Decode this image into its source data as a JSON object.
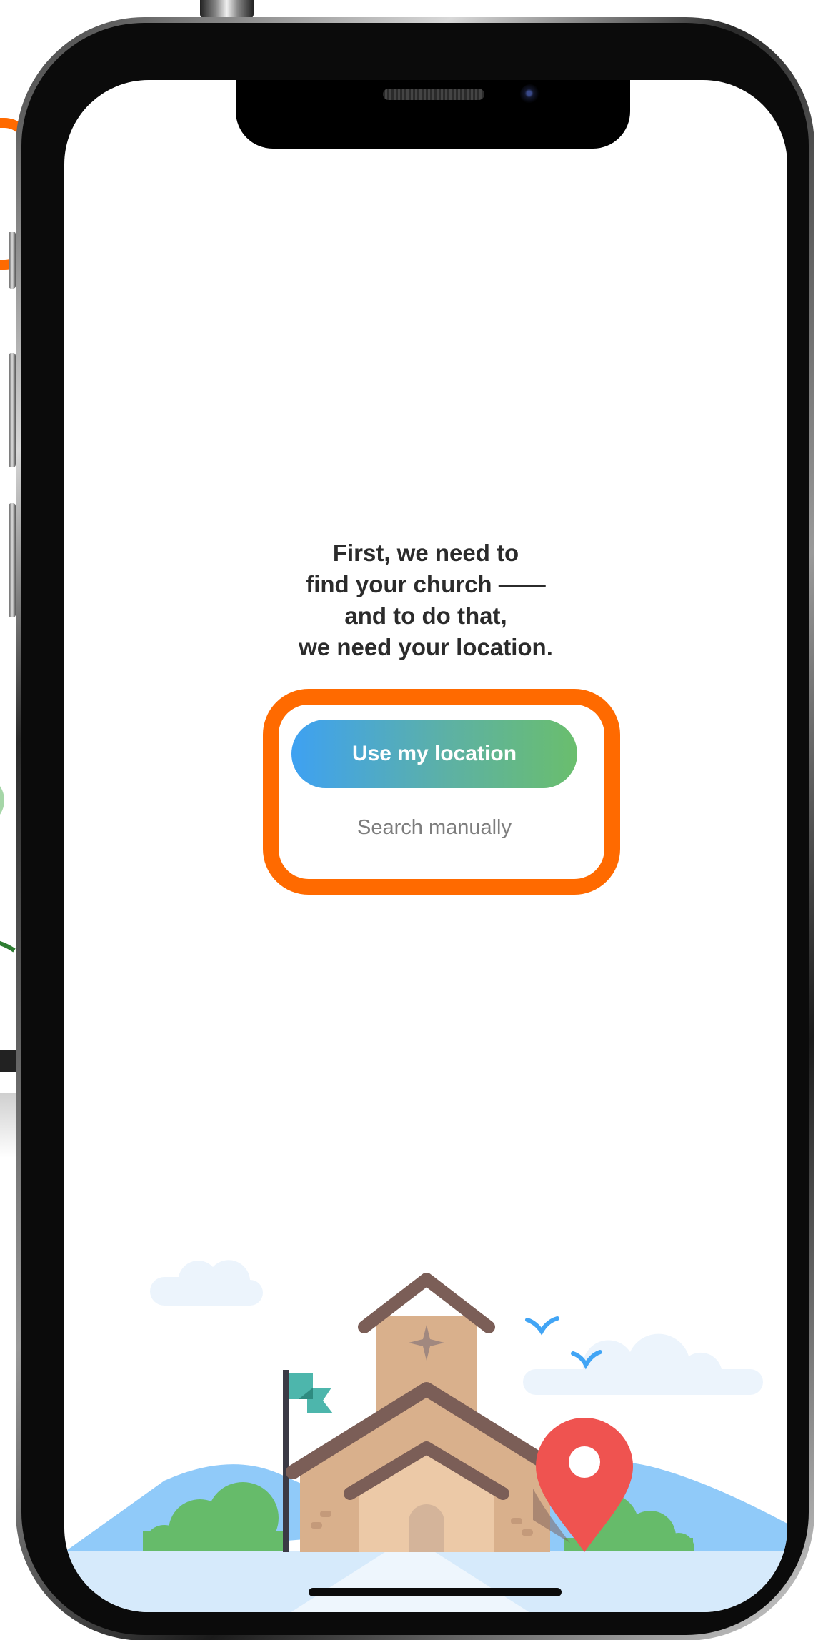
{
  "onboarding": {
    "message_lines": [
      "First, we need to",
      "find your church ——",
      "and to do that,",
      "we need your location."
    ],
    "primary_button_label": "Use my location",
    "secondary_link_label": "Search manually"
  },
  "colors": {
    "highlight": "#ff6a00",
    "button_gradient_start": "#3ea1f2",
    "button_gradient_end": "#6abe6d",
    "map_pin": "#ef5350",
    "flag": "#4db6ac",
    "roof": "#7b5e57",
    "wall": "#d9b08c"
  },
  "icons": {
    "pin": "map-pin-icon",
    "cross": "cross-icon",
    "flag": "flag-icon"
  }
}
